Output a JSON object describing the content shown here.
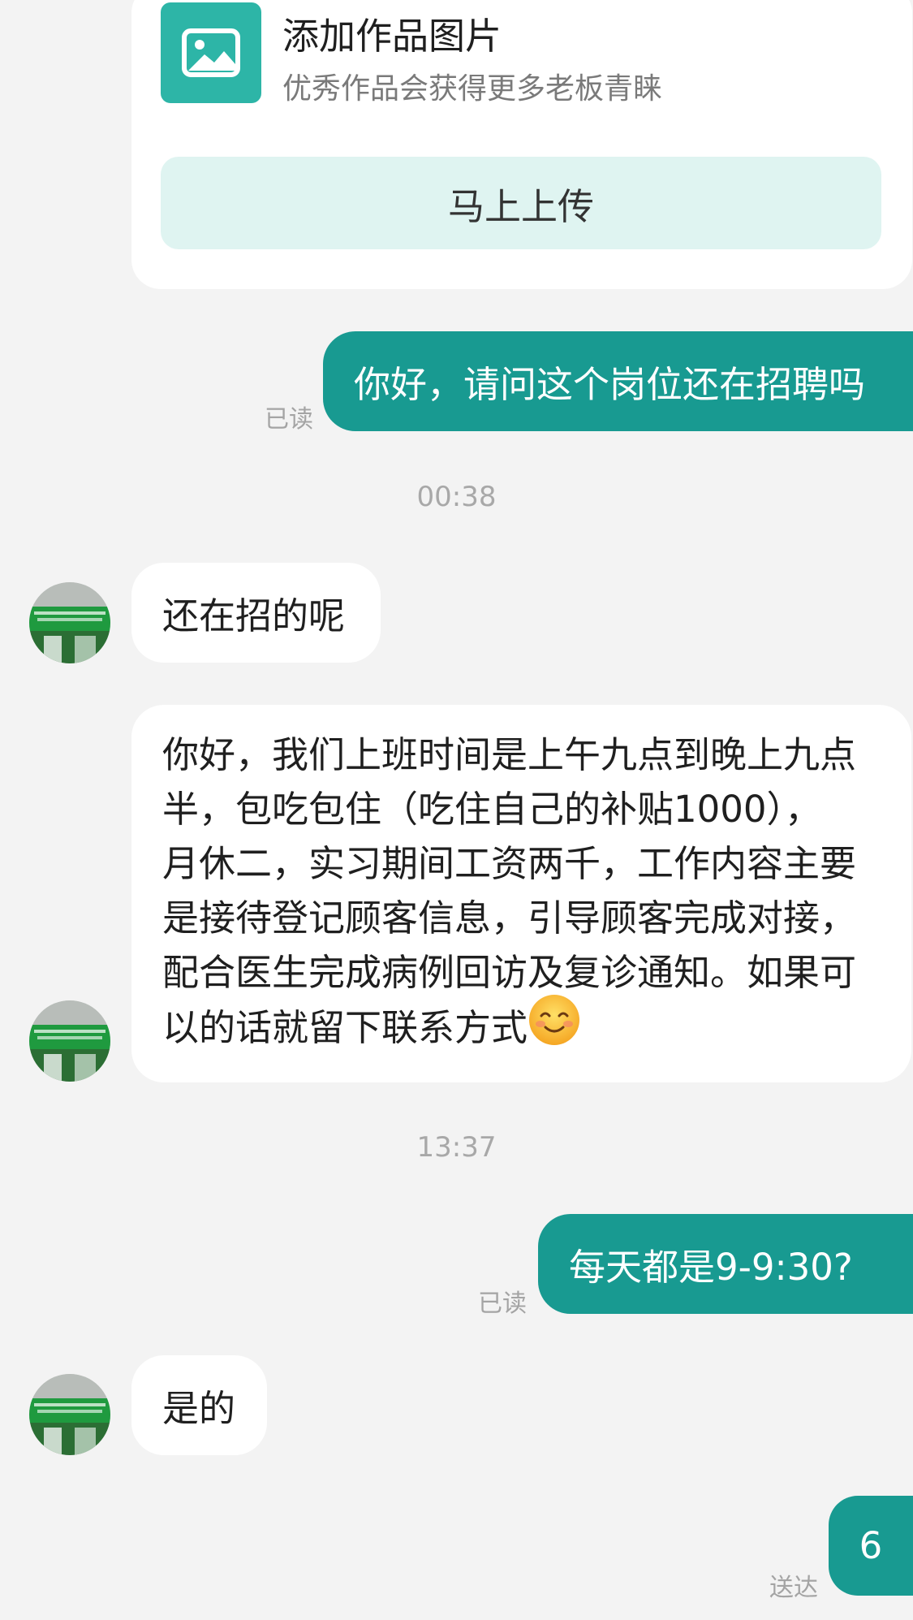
{
  "upload_card": {
    "icon": "image-icon",
    "title": "添加作品图片",
    "subtitle": "优秀作品会获得更多老板青睐",
    "button_label": "马上上传"
  },
  "messages": {
    "m1": {
      "text": "你好，请问这个岗位还在招聘吗",
      "status": "已读"
    },
    "t1": "00:38",
    "m2": {
      "text": "还在招的呢"
    },
    "m3": {
      "lines": [
        "你好，我们上班时间是上午九点到晚上九点",
        "半，包吃包住（吃住自己的补贴1000），",
        "月休二，实习期间工资两千，工作内容主要",
        "是接待登记顾客信息，引导顾客完成对接，",
        "配合医生完成病例回访及复诊通知。如果可",
        "以的话就留下联系方式"
      ],
      "emoji": "smiling-face-emoji"
    },
    "t2": "13:37",
    "m4": {
      "text": "每天都是9-9:30?",
      "status": "已读"
    },
    "m5": {
      "text": "是的"
    },
    "m6": {
      "text": "6",
      "status": "送达"
    }
  },
  "colors": {
    "outgoing_bubble": "#189a91",
    "upload_icon_bg": "#2db5a7",
    "upload_button_bg": "#dff4f1",
    "background": "#f3f3f3"
  }
}
